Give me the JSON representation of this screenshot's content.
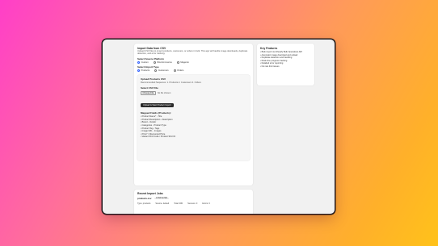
{
  "main": {
    "title": "Import Data from CSV",
    "description": "Upload CSV files to import products, customers, or orders in bulk. This app will handle image downloads, duplicate detection, and error tracking.",
    "platform": {
      "heading": "Select Source Platform",
      "options": [
        "Custom",
        "WooCommerce",
        "Magento"
      ],
      "selected": "Custom"
    },
    "import_type": {
      "heading": "Select Import Type",
      "options": [
        "Products",
        "Customers",
        "Orders"
      ],
      "selected": "Products"
    },
    "upload": {
      "heading": "Upload Products CSV",
      "sequence": "Recommended Sequence: 1. Products 2. Customers 3. Orders",
      "select_label": "Select CSV File",
      "choose_file_label": "Choose File",
      "no_file_text": "No file chosen",
      "upload_button_label": "Upload & Start Product Import",
      "mapped_heading": "Mapped Fields (Products):",
      "mapped_fields": [
        "• Product Name* - Title",
        "• Product Description - Description",
        "• Brand - Vendor",
        "• Categories - Product Type",
        "• Product Tag - Tags",
        "• Image URL - Images",
        "• Price* / Discounted Price",
        "• Variant SKU Code / Product SKU ID"
      ]
    }
  },
  "side": {
    "title": "Key Features",
    "features": [
      "• Bulk import via Shopify Bulk Operations API",
      "• Automatic image download and upload",
      "• Duplicate detection and handling",
      "• Real-time progress tracking",
      "• Detailed error reporting",
      "• No rate limit issues"
    ]
  },
  "recent": {
    "title": "Recent Import Jobs",
    "file_name": "products.csv",
    "status": "COMPLETED",
    "stats": [
      "Type: products",
      "Source: default",
      "Total: 480",
      "Success: 0",
      "Errors: 0"
    ]
  }
}
